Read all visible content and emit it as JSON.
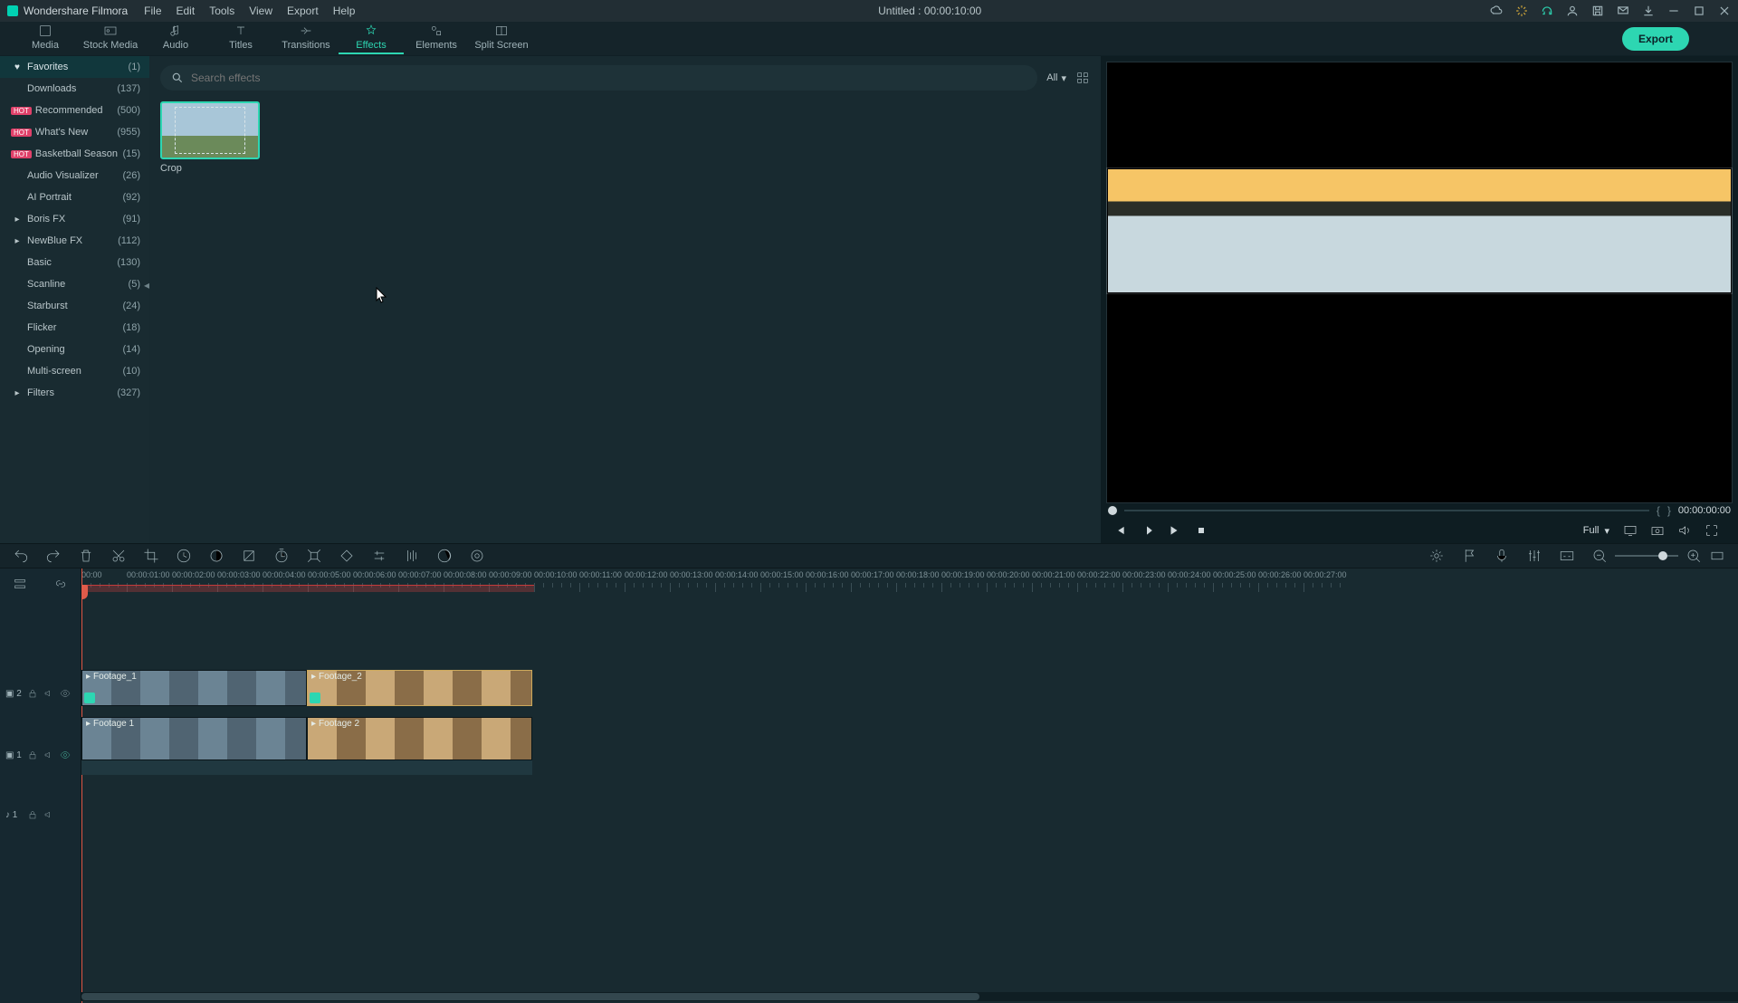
{
  "app_name": "Wondershare Filmora",
  "menu": [
    "File",
    "Edit",
    "Tools",
    "View",
    "Export",
    "Help"
  ],
  "project_title": "Untitled : 00:00:10:00",
  "tabs": [
    {
      "label": "Media"
    },
    {
      "label": "Stock Media"
    },
    {
      "label": "Audio"
    },
    {
      "label": "Titles"
    },
    {
      "label": "Transitions"
    },
    {
      "label": "Effects",
      "active": true
    },
    {
      "label": "Elements"
    },
    {
      "label": "Split Screen"
    }
  ],
  "export_label": "Export",
  "sidebar": [
    {
      "pre": "♥",
      "label": "Favorites",
      "count": "(1)",
      "active": true
    },
    {
      "pre": "",
      "label": "Downloads",
      "count": "(137)"
    },
    {
      "pre": "hot",
      "label": "Recommended",
      "count": "(500)"
    },
    {
      "pre": "hot",
      "label": "What's New",
      "count": "(955)"
    },
    {
      "pre": "hot",
      "label": "Basketball Season",
      "count": "(15)"
    },
    {
      "pre": "",
      "label": "Audio Visualizer",
      "count": "(26)"
    },
    {
      "pre": "",
      "label": "AI Portrait",
      "count": "(92)"
    },
    {
      "pre": "▸",
      "label": "Boris FX",
      "count": "(91)"
    },
    {
      "pre": "▸",
      "label": "NewBlue FX",
      "count": "(112)"
    },
    {
      "pre": "",
      "label": "Basic",
      "count": "(130)"
    },
    {
      "pre": "",
      "label": "Scanline",
      "count": "(5)"
    },
    {
      "pre": "",
      "label": "Starburst",
      "count": "(24)"
    },
    {
      "pre": "",
      "label": "Flicker",
      "count": "(18)"
    },
    {
      "pre": "",
      "label": "Opening",
      "count": "(14)"
    },
    {
      "pre": "",
      "label": "Multi-screen",
      "count": "(10)"
    },
    {
      "pre": "▸",
      "label": "Filters",
      "count": "(327)"
    }
  ],
  "search": {
    "placeholder": "Search effects",
    "filter_label": "All"
  },
  "effect_card": {
    "name": "Crop"
  },
  "preview": {
    "time_current": "00:00:00:00",
    "mark_in": "{",
    "mark_out": "}",
    "quality_label": "Full"
  },
  "timeline": {
    "ticks": [
      "00:00",
      "00:00:01:00",
      "00:00:02:00",
      "00:00:03:00",
      "00:00:04:00",
      "00:00:05:00",
      "00:00:06:00",
      "00:00:07:00",
      "00:00:08:00",
      "00:00:09:00",
      "00:00:10:00",
      "00:00:11:00",
      "00:00:12:00",
      "00:00:13:00",
      "00:00:14:00",
      "00:00:15:00",
      "00:00:16:00",
      "00:00:17:00",
      "00:00:18:00",
      "00:00:19:00",
      "00:00:20:00",
      "00:00:21:00",
      "00:00:22:00",
      "00:00:23:00",
      "00:00:24:00",
      "00:00:25:00",
      "00:00:26:00",
      "00:00:27:00"
    ],
    "tracks": {
      "v2": {
        "name": "▣ 2"
      },
      "v1": {
        "name": "▣ 1"
      },
      "a1": {
        "name": "♪ 1"
      }
    },
    "clips": {
      "v2a": {
        "label": "Footage_1"
      },
      "v2b": {
        "label": "Footage_2"
      },
      "v1a": {
        "label": "Footage 1"
      },
      "v1b": {
        "label": "Footage 2"
      }
    }
  }
}
